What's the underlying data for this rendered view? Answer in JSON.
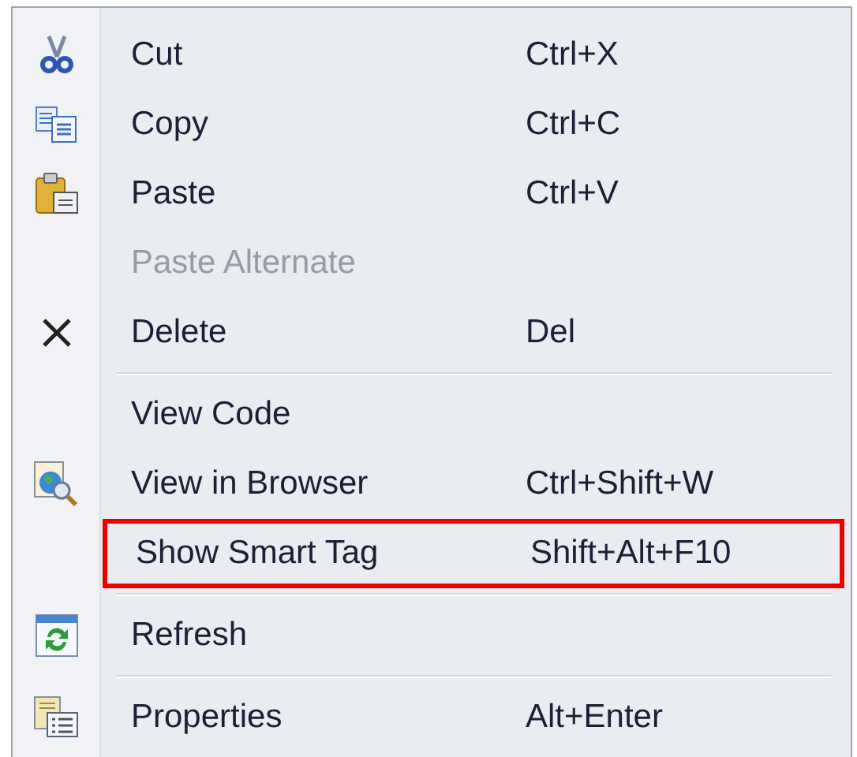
{
  "menu": {
    "items": [
      {
        "kind": "item",
        "label": "Cut",
        "shortcut": "Ctrl+X",
        "disabled": false,
        "highlighted": false
      },
      {
        "kind": "item",
        "label": "Copy",
        "shortcut": "Ctrl+C",
        "disabled": false,
        "highlighted": false
      },
      {
        "kind": "item",
        "label": "Paste",
        "shortcut": "Ctrl+V",
        "disabled": false,
        "highlighted": false
      },
      {
        "kind": "item",
        "label": "Paste Alternate",
        "disabled": true,
        "highlighted": false
      },
      {
        "kind": "item",
        "label": "Delete",
        "shortcut": "Del",
        "disabled": false,
        "highlighted": false
      },
      {
        "kind": "separator"
      },
      {
        "kind": "item",
        "label": "View Code",
        "disabled": false,
        "highlighted": false
      },
      {
        "kind": "item",
        "label": "View in Browser",
        "shortcut": "Ctrl+Shift+W",
        "disabled": false,
        "highlighted": false
      },
      {
        "kind": "item",
        "label": "Show Smart Tag",
        "shortcut": "Shift+Alt+F10",
        "disabled": false,
        "highlighted": true
      },
      {
        "kind": "separator"
      },
      {
        "kind": "item",
        "label": "Refresh",
        "disabled": false,
        "highlighted": false
      },
      {
        "kind": "separator"
      },
      {
        "kind": "item",
        "label": "Properties",
        "shortcut": "Alt+Enter",
        "disabled": false,
        "highlighted": false
      }
    ]
  }
}
